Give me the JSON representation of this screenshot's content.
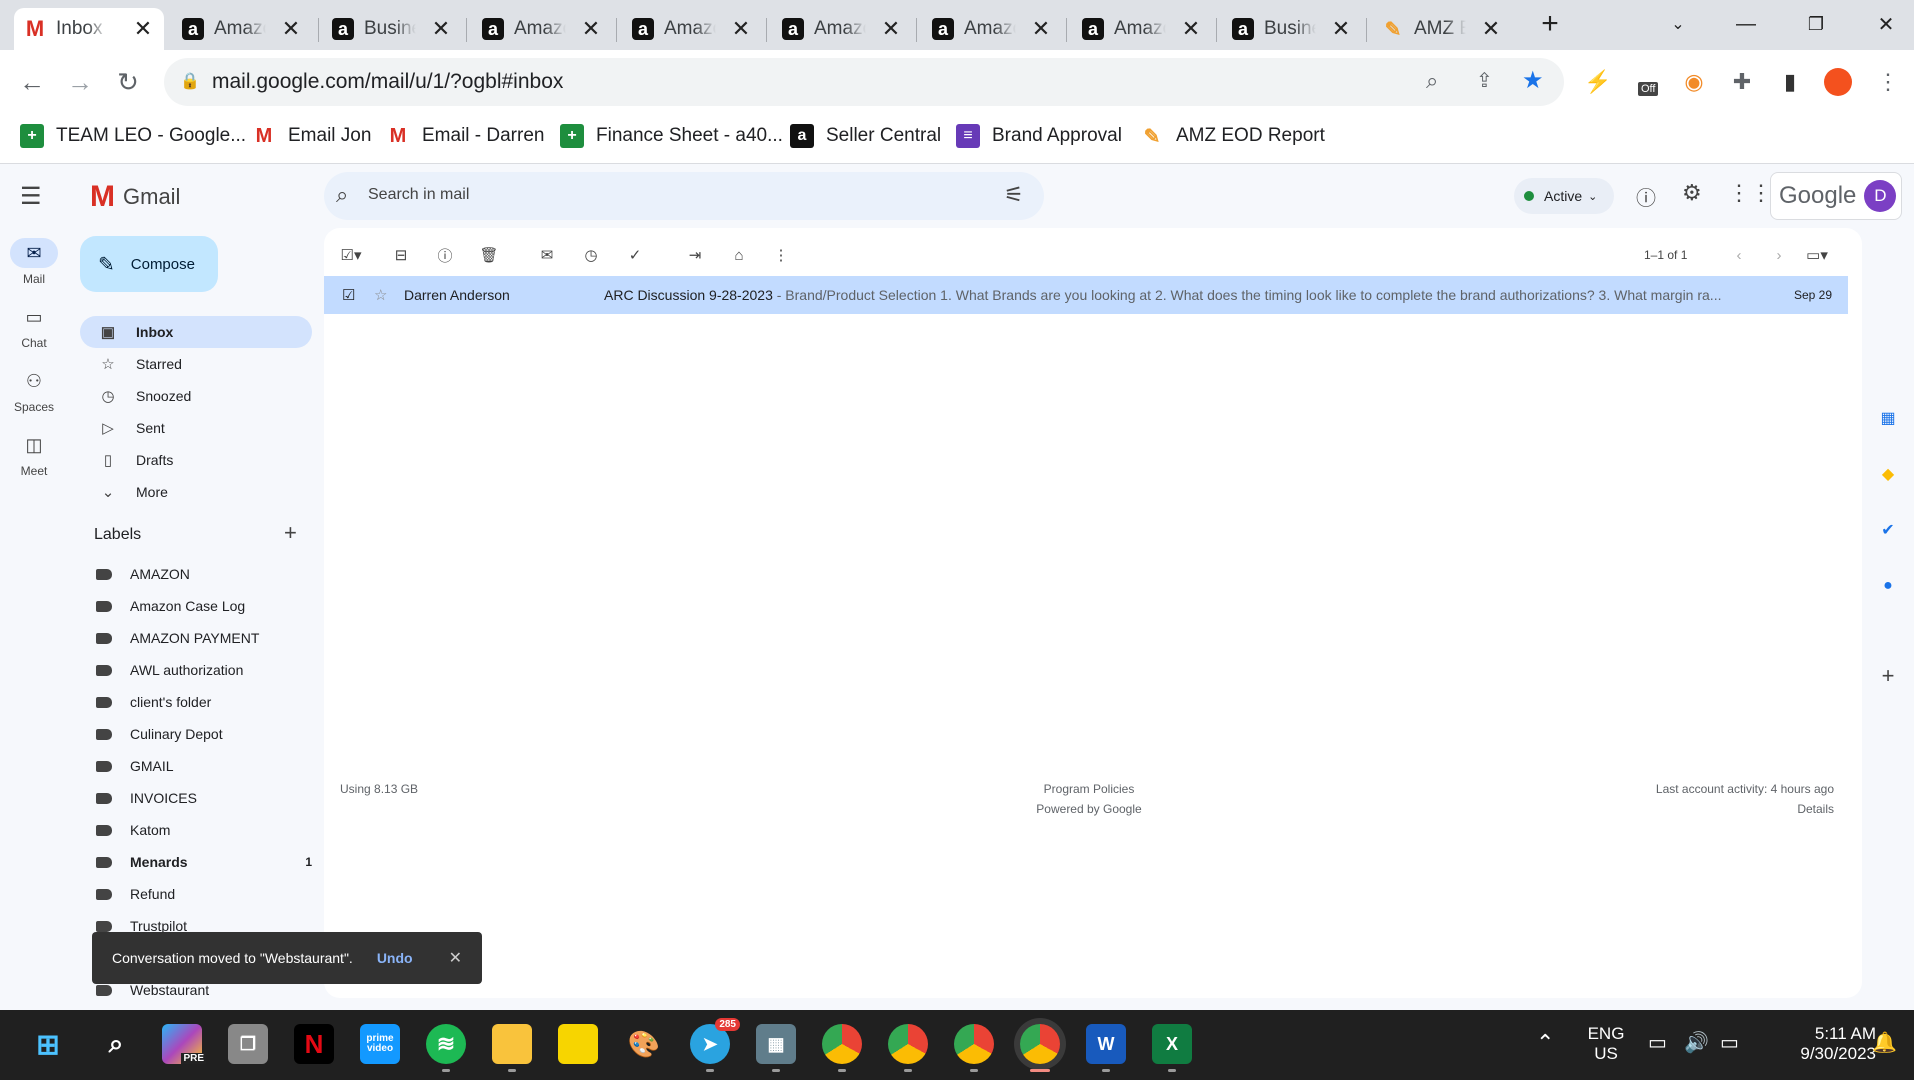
{
  "browser": {
    "tabs": [
      {
        "title": "Inbox",
        "icon": "gmail-icon",
        "active": true
      },
      {
        "title": "Amazon",
        "icon": "amazon-icon"
      },
      {
        "title": "Business",
        "icon": "amazon-icon"
      },
      {
        "title": "Amazon",
        "icon": "amazon-icon"
      },
      {
        "title": "Amazon",
        "icon": "amazon-icon"
      },
      {
        "title": "Amazon",
        "icon": "amazon-icon"
      },
      {
        "title": "Amazon",
        "icon": "amazon-icon"
      },
      {
        "title": "Amazon",
        "icon": "amazon-icon"
      },
      {
        "title": "Business",
        "icon": "amazon-icon"
      },
      {
        "title": "AMZ EOD",
        "icon": "amz-report-icon"
      }
    ],
    "url": "mail.google.com/mail/u/1/?ogbl#inbox",
    "extensions": {
      "off_badge": "Off"
    },
    "bookmarks": [
      {
        "label": "TEAM LEO - Google...",
        "icon": "sheets-icon",
        "color": "#1e8e3e"
      },
      {
        "label": "Email Jon",
        "icon": "gmail-icon",
        "color": "#d93025"
      },
      {
        "label": "Email - Darren",
        "icon": "gmail-icon",
        "color": "#d93025"
      },
      {
        "label": "Finance Sheet - a40...",
        "icon": "sheets-icon",
        "color": "#1e8e3e"
      },
      {
        "label": "Seller Central",
        "icon": "amazon-icon",
        "color": "#111111"
      },
      {
        "label": "Brand Approval",
        "icon": "forms-icon",
        "color": "#673ab7"
      },
      {
        "label": "AMZ EOD Report",
        "icon": "amz-report-icon",
        "color": "#f0a030"
      }
    ]
  },
  "gmail": {
    "logo_text": "Gmail",
    "search_placeholder": "Search in mail",
    "status": "Active",
    "google_text": "Google",
    "avatar_letter": "D",
    "rail": [
      {
        "label": "Mail",
        "icon": "mail-icon"
      },
      {
        "label": "Chat",
        "icon": "chat-icon"
      },
      {
        "label": "Spaces",
        "icon": "spaces-icon"
      },
      {
        "label": "Meet",
        "icon": "meet-icon"
      }
    ],
    "compose": "Compose",
    "nav": [
      {
        "label": "Inbox",
        "icon": "inbox-icon"
      },
      {
        "label": "Starred",
        "icon": "star-icon"
      },
      {
        "label": "Snoozed",
        "icon": "clock-icon"
      },
      {
        "label": "Sent",
        "icon": "send-icon"
      },
      {
        "label": "Drafts",
        "icon": "draft-icon"
      },
      {
        "label": "More",
        "icon": "chevron-down-icon"
      }
    ],
    "labels_title": "Labels",
    "labels": [
      {
        "name": "AMAZON"
      },
      {
        "name": "Amazon Case Log"
      },
      {
        "name": "AMAZON PAYMENT"
      },
      {
        "name": "AWL authorization"
      },
      {
        "name": "client's folder"
      },
      {
        "name": "Culinary Depot"
      },
      {
        "name": "GMAIL"
      },
      {
        "name": "INVOICES"
      },
      {
        "name": "Katom"
      },
      {
        "name": "Menards",
        "count": "1"
      },
      {
        "name": "Refund"
      },
      {
        "name": "Trustpilot"
      },
      {
        "name": "Webstaurant"
      }
    ],
    "pagination": "1–1 of 1",
    "message": {
      "sender": "Darren Anderson",
      "subject": "ARC Discussion 9-28-2023",
      "snippet": " - Brand/Product Selection 1. What Brands are you looking at 2. What does the timing look like to complete the brand authorizations? 3. What margin ra...",
      "date": "Sep 29"
    },
    "footer": {
      "storage": "Using 8.13 GB",
      "policies": "Program Policies",
      "powered": "Powered by Google",
      "activity": "Last account activity: 4 hours ago",
      "details": "Details"
    },
    "toast": {
      "text": "Conversation moved to \"Webstaurant\".",
      "action": "Undo"
    }
  },
  "taskbar": {
    "badge_count": "285",
    "lang": "ENG",
    "region": "US",
    "time": "5:11 AM",
    "date": "9/30/2023",
    "pre_label": "PRE",
    "prime_label": "prime video"
  },
  "colors": {
    "accent": "#0b57d0",
    "selected_row": "#c2dbff",
    "compose": "#c2e7ff"
  }
}
